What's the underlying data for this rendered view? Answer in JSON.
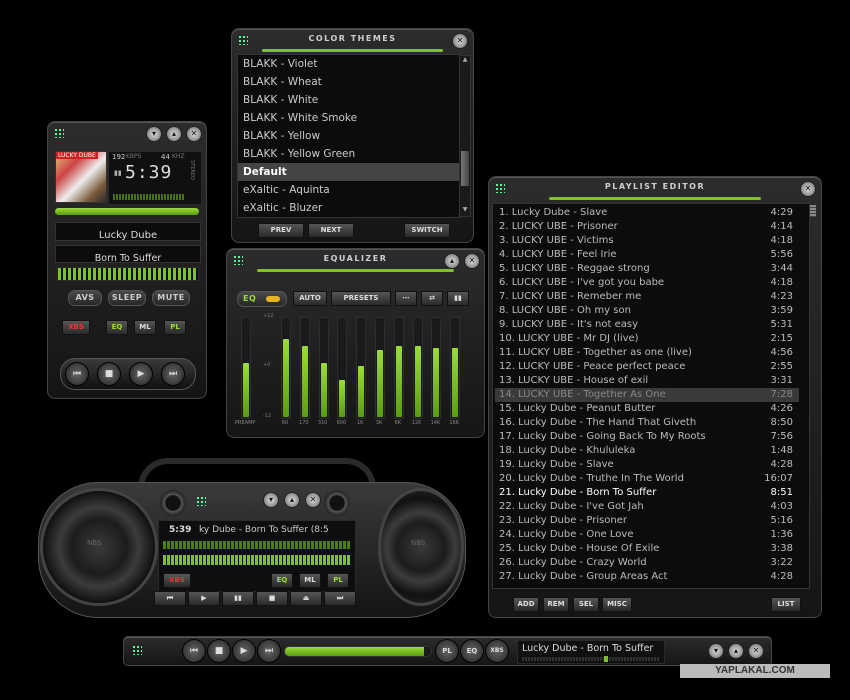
{
  "color_themes": {
    "title": "COLOR THEMES",
    "items": [
      "BLAKK - Violet",
      "BLAKK - Wheat",
      "BLAKK - White",
      "BLAKK - White Smoke",
      "BLAKK - Yellow",
      "BLAKK - Yellow Green",
      "Default",
      "eXaltic - Aquinta",
      "eXaltic - Bluzer"
    ],
    "selected_index": 6,
    "prev": "PREV",
    "next": "NEXT",
    "switch": "SWITCH"
  },
  "main_player": {
    "kbps": "192",
    "kbps_unit": "KBPS",
    "khz": "44",
    "khz_unit": "KHZ",
    "stereo": "STEREO",
    "time": "5:39",
    "artist": "Lucky Dube",
    "title": "Born To Suffer",
    "btn_avs": "AVS",
    "btn_sleep": "SLEEP",
    "btn_mute": "MUTE",
    "btn_xbs": "XBS",
    "btn_eq": "EQ",
    "btn_ml": "ML",
    "btn_pl": "PL"
  },
  "equalizer": {
    "title": "EQUALIZER",
    "eq_toggle": "EQ",
    "auto": "AUTO",
    "presets": "PRESETS",
    "scale_top": "+12",
    "scale_mid": "+0",
    "scale_bot": "-12",
    "preamp_label": "PREAMP",
    "preamp_level": 0.55,
    "bands": [
      {
        "label": "60",
        "level": 0.8
      },
      {
        "label": "170",
        "level": 0.72
      },
      {
        "label": "310",
        "level": 0.55
      },
      {
        "label": "600",
        "level": 0.38
      },
      {
        "label": "1K",
        "level": 0.52
      },
      {
        "label": "3K",
        "level": 0.68
      },
      {
        "label": "6K",
        "level": 0.72
      },
      {
        "label": "12K",
        "level": 0.72
      },
      {
        "label": "14K",
        "level": 0.7
      },
      {
        "label": "16K",
        "level": 0.7
      }
    ]
  },
  "playlist": {
    "title": "PLAYLIST EDITOR",
    "selected_index": 13,
    "playing_index": 20,
    "items": [
      {
        "t": "1. Lucky Dube - Slave",
        "d": "4:29"
      },
      {
        "t": "2. LUCKY UBE - Prisoner",
        "d": "4:14"
      },
      {
        "t": "3. LUCKY UBE - Victims",
        "d": "4:18"
      },
      {
        "t": "4. LUCKY UBE - Feel Irie",
        "d": "5:56"
      },
      {
        "t": "5. LUCKY UBE - Reggae strong",
        "d": "3:44"
      },
      {
        "t": "6. LUCKY UBE - I've got you babe",
        "d": "4:18"
      },
      {
        "t": "7. LUCKY UBE - Remeber me",
        "d": "4:23"
      },
      {
        "t": "8. LUCKY UBE - Oh my son",
        "d": "3:59"
      },
      {
        "t": "9. LUCKY UBE - It's not easy",
        "d": "5:31"
      },
      {
        "t": "10. LUCKY UBE - Mr DJ (live)",
        "d": "2:15"
      },
      {
        "t": "11. LUCKY UBE - Together as one (live)",
        "d": "4:56"
      },
      {
        "t": "12. LUCKY UBE - Peace perfect peace",
        "d": "2:55"
      },
      {
        "t": "13. LUCKY UBE - House of exil",
        "d": "3:31"
      },
      {
        "t": "14. LUCKY UBE - Together As One",
        "d": "7:28"
      },
      {
        "t": "15. Lucky Dube - Peanut Butter",
        "d": "4:26"
      },
      {
        "t": "16. Lucky Dube - The Hand That Giveth",
        "d": "8:50"
      },
      {
        "t": "17. Lucky Dube - Going Back To My Roots",
        "d": "7:56"
      },
      {
        "t": "18. Lucky Dube - Khululeka",
        "d": "1:48"
      },
      {
        "t": "19. Lucky Dube - Slave",
        "d": "4:28"
      },
      {
        "t": "20. Lucky Dube - Truthe In The World",
        "d": "16:07"
      },
      {
        "t": "21. Lucky Dube - Born To Suffer",
        "d": "8:51"
      },
      {
        "t": "22. Lucky Dube - I've Got Jah",
        "d": "4:03"
      },
      {
        "t": "23. Lucky Dube - Prisoner",
        "d": "5:16"
      },
      {
        "t": "24. Lucky Dube - One Love",
        "d": "1:36"
      },
      {
        "t": "25. Lucky Dube - House Of Exile",
        "d": "3:38"
      },
      {
        "t": "26. Lucky Dube - Crazy World",
        "d": "3:22"
      },
      {
        "t": "27. Lucky Dube - Group Areas Act",
        "d": "4:28"
      }
    ],
    "btn_add": "ADD",
    "btn_rem": "REM",
    "btn_sel": "SEL",
    "btn_misc": "MISC",
    "btn_list": "LIST"
  },
  "boombox": {
    "time": "5:39",
    "ticker": "ky Dube - Born To Suffer (8:5",
    "speaker_logo": "NBS",
    "btn_xbs": "XBS",
    "btn_eq": "EQ",
    "btn_ml": "ML",
    "btn_pl": "PL"
  },
  "mini_bar": {
    "progress": 0.95,
    "ticker": "Lucky Dube - Born To Suffer",
    "btn_pl": "PL",
    "btn_eq": "EQ",
    "btn_xbs": "XBS"
  },
  "watermark": "YAPLAKAL.COM"
}
